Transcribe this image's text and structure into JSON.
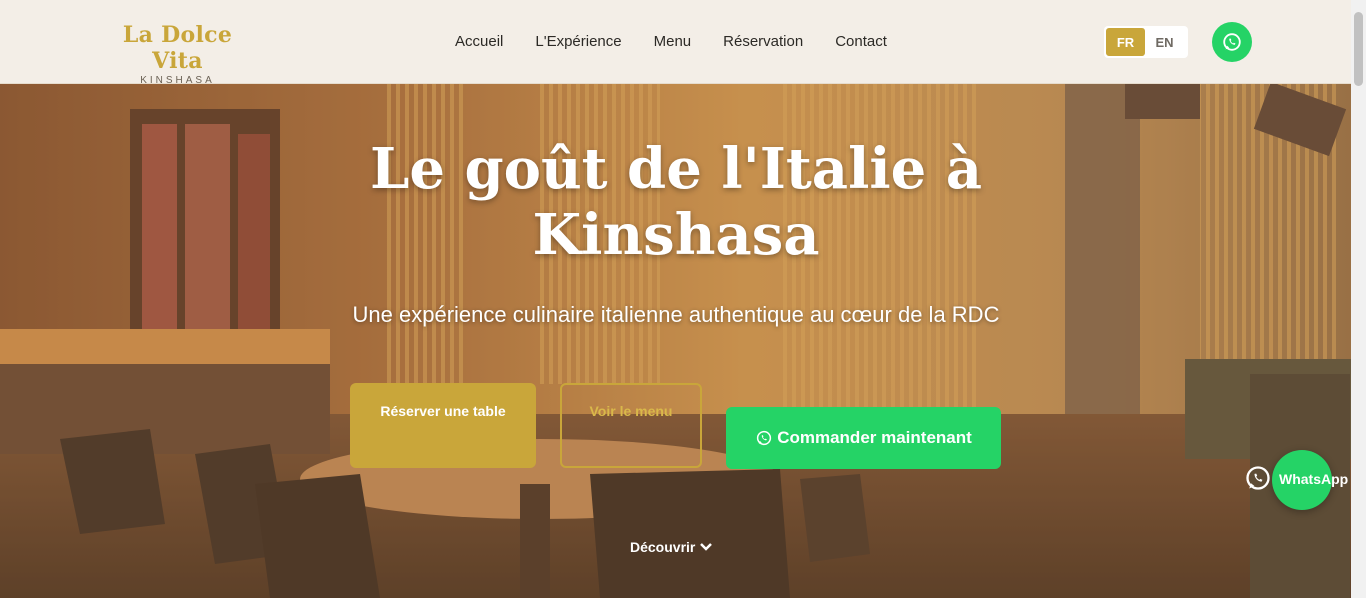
{
  "brand": {
    "name": "La Dolce Vita",
    "city": "KINSHASA"
  },
  "nav": {
    "items": [
      {
        "label": "Accueil"
      },
      {
        "label": "L'Expérience"
      },
      {
        "label": "Menu"
      },
      {
        "label": "Réservation"
      },
      {
        "label": "Contact"
      }
    ]
  },
  "lang": {
    "fr": "FR",
    "en": "EN",
    "active": "FR"
  },
  "hero": {
    "title": "Le goût de l'Italie à Kinshasa",
    "subtitle": "Une expérience culinaire italienne authentique au cœur de la RDC",
    "reserve_label": "Réserver une table",
    "menu_label": "Voir le menu",
    "order_label": "Commander maintenant",
    "discover_label": "Découvrir"
  },
  "whatsapp_float": {
    "label": "WhatsApp"
  },
  "colors": {
    "gold": "#c9a63a",
    "whatsapp": "#25d366",
    "header_bg": "#f3eee7"
  }
}
